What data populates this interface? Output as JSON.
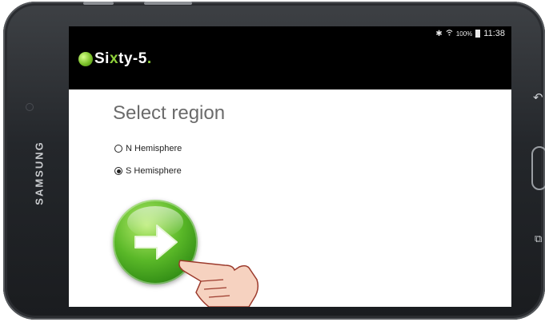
{
  "device": {
    "brand": "SAMSUNG"
  },
  "status_bar": {
    "icons": [
      "bluetooth-icon",
      "wifi-icon",
      "battery-icon"
    ],
    "battery": "100%",
    "time": "11:38"
  },
  "app": {
    "logo_pre": "Si",
    "logo_accent": "x",
    "logo_post": "ty-5",
    "logo_dot": "."
  },
  "screen": {
    "title": "Select region",
    "options": [
      {
        "label": "N Hemisphere",
        "selected": false
      },
      {
        "label": "S Hemisphere",
        "selected": true
      }
    ],
    "next_button_icon": "arrow-right-icon"
  },
  "colors": {
    "accent": "#5ab828",
    "header_bg": "#000000",
    "bezel": "#2a2c30"
  }
}
